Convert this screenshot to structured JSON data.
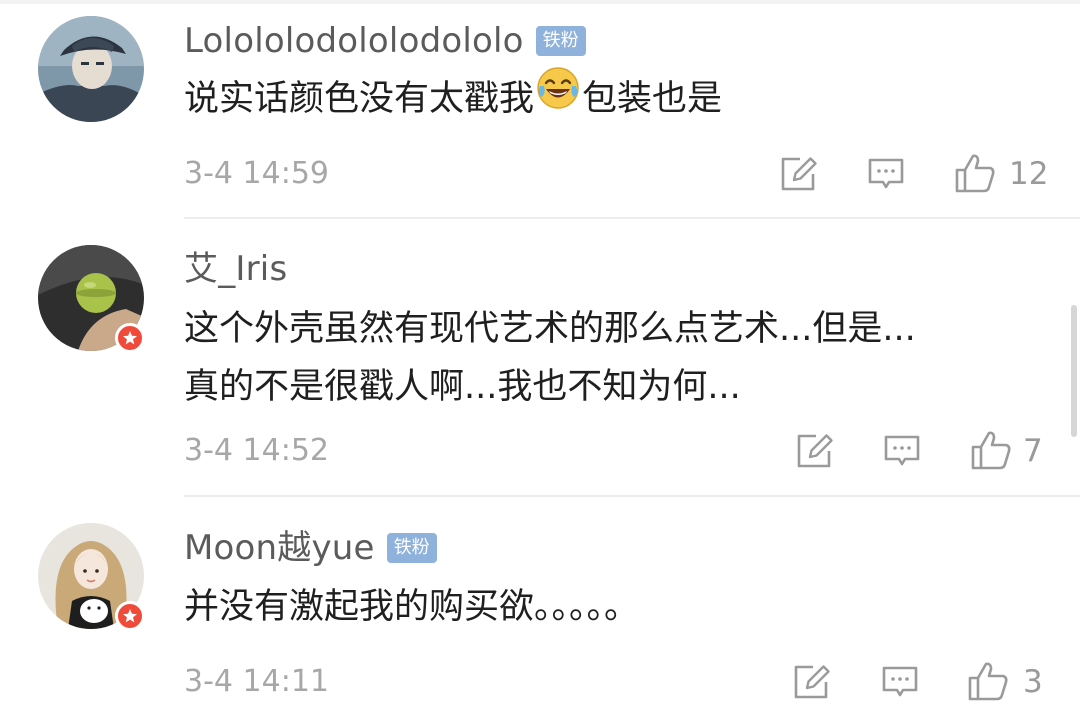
{
  "comments": [
    {
      "username": "Lolololodololodololo",
      "badge": "铁粉",
      "text_before_emoji": "说实话颜色没有太戳我",
      "emoji": "laughing-tears-emoji",
      "text_after_emoji": "包装也是",
      "time": "3-4 14:59",
      "likes": "12"
    },
    {
      "username": "艾_Iris",
      "verified": true,
      "text_line1": "这个外壳虽然有现代艺术的那么点艺术...但是...",
      "text_line2": "真的不是很戳人啊...我也不知为何...",
      "time": "3-4 14:52",
      "likes": "7"
    },
    {
      "username": "Moon越yue",
      "badge": "铁粉",
      "verified": true,
      "text": "并没有激起我的购买欲。。。。。",
      "time": "3-4 14:11",
      "likes": "3"
    }
  ],
  "icons": {
    "repost": "repost-icon",
    "comment": "comment-icon",
    "like": "thumbs-up-icon",
    "verified": "verified-star-icon"
  },
  "colors": {
    "badge_bg": "#8fb2dd",
    "verified_badge": "#f04b3a",
    "meta_text": "#a7a7a7",
    "username_text": "#5b5b5b",
    "body_text": "#1f1f1f"
  }
}
